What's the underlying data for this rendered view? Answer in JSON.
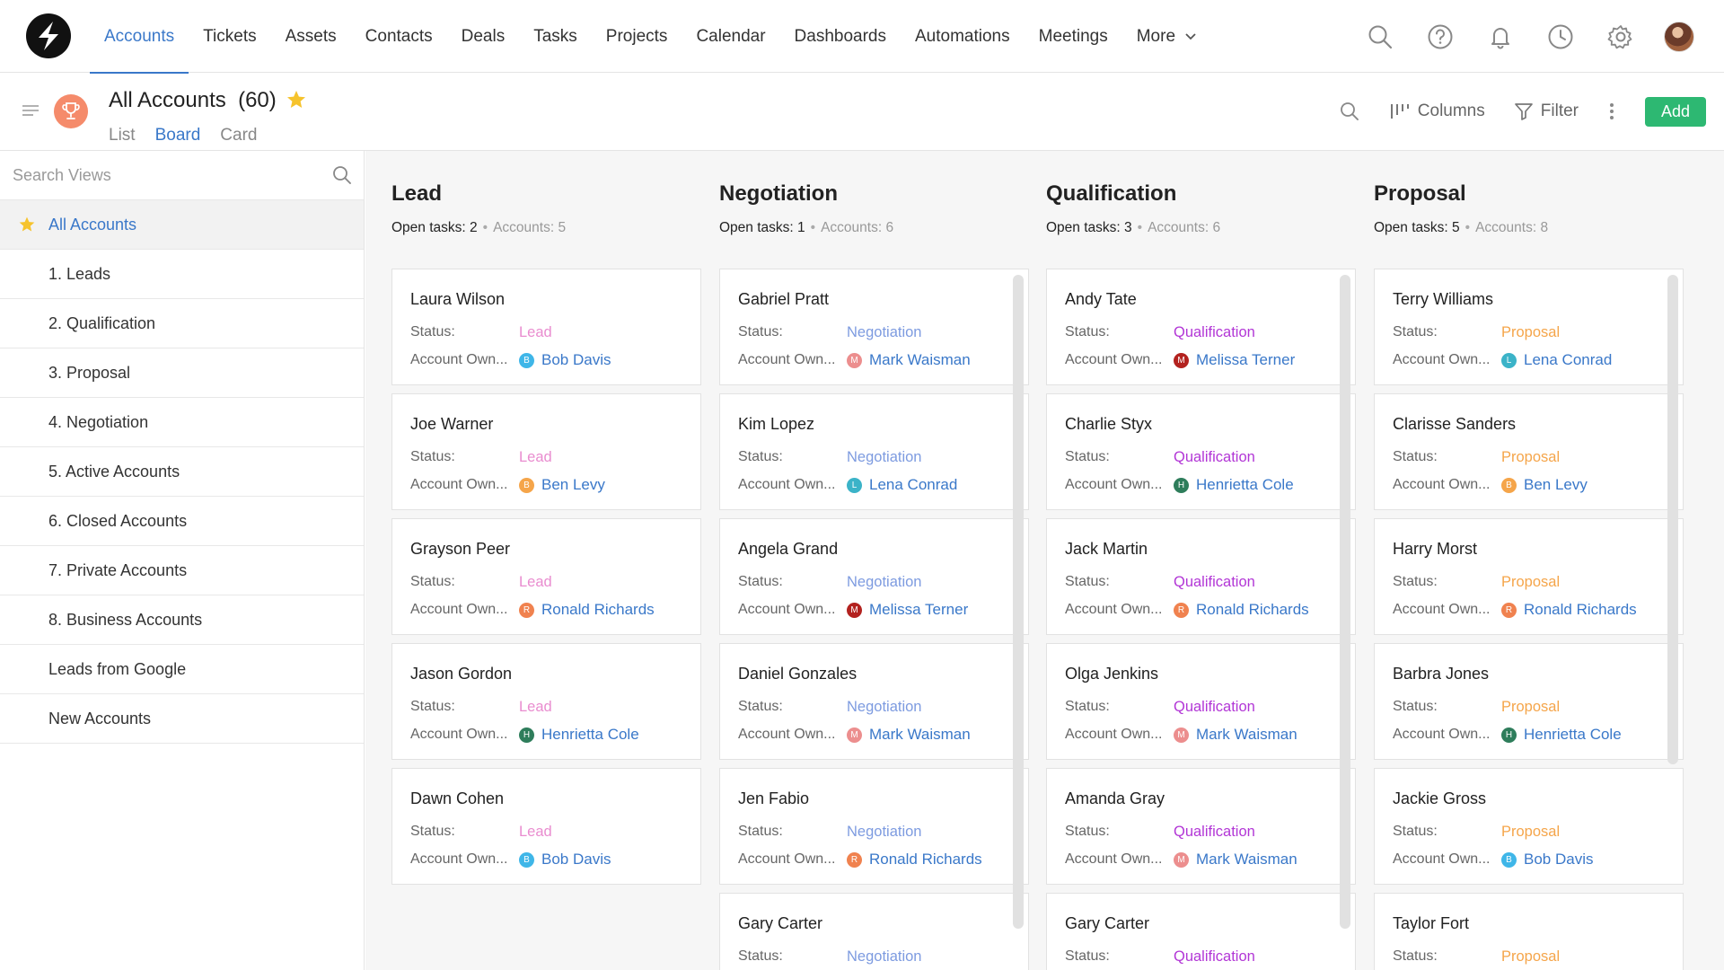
{
  "nav": {
    "links": [
      "Accounts",
      "Tickets",
      "Assets",
      "Contacts",
      "Deals",
      "Tasks",
      "Projects",
      "Calendar",
      "Dashboards",
      "Automations",
      "Meetings",
      "More"
    ],
    "active_index": 0
  },
  "header": {
    "title": "All Accounts",
    "count": "(60)",
    "view_tabs": [
      "List",
      "Board",
      "Card"
    ],
    "active_view": 1,
    "columns_label": "Columns",
    "filter_label": "Filter",
    "add_label": "Add"
  },
  "sidebar": {
    "search_placeholder": "Search Views",
    "items": [
      "All Accounts",
      "1. Leads",
      "2. Qualification",
      "3. Proposal",
      "4. Negotiation",
      "5. Active Accounts",
      "6. Closed Accounts",
      "7. Private Accounts",
      "8. Business Accounts",
      "Leads from Google",
      "New Accounts"
    ],
    "active_index": 0
  },
  "labels": {
    "status": "Status:",
    "owner": "Account Own..."
  },
  "owners": {
    "Bob Davis": {
      "initial": "B",
      "color": "#3fb6e8"
    },
    "Ben Levy": {
      "initial": "B",
      "color": "#f5a54a"
    },
    "Ronald Richards": {
      "initial": "R",
      "color": "#f0824f"
    },
    "Henrietta Cole": {
      "initial": "H",
      "color": "#2e7d5b"
    },
    "Mark Waisman": {
      "initial": "M",
      "color": "#ec8e8e"
    },
    "Lena Conrad": {
      "initial": "L",
      "color": "#3bb3c8"
    },
    "Melissa Terner": {
      "initial": "M",
      "color": "#b3221f"
    }
  },
  "columns": [
    {
      "title": "Lead",
      "open_tasks": "Open tasks: 2",
      "accounts": "Accounts: 5",
      "status": "Lead",
      "status_color": "#e98ccf",
      "cards": [
        {
          "name": "Laura Wilson",
          "owner": "Bob Davis"
        },
        {
          "name": "Joe Warner",
          "owner": "Ben Levy"
        },
        {
          "name": "Grayson Peer",
          "owner": "Ronald Richards"
        },
        {
          "name": "Jason Gordon",
          "owner": "Henrietta Cole"
        },
        {
          "name": "Dawn Cohen",
          "owner": "Bob Davis"
        }
      ]
    },
    {
      "title": "Negotiation",
      "open_tasks": "Open tasks: 1",
      "accounts": "Accounts: 6",
      "status": "Negotiation",
      "status_color": "#7d9be0",
      "cards": [
        {
          "name": "Gabriel Pratt",
          "owner": "Mark Waisman"
        },
        {
          "name": "Kim Lopez",
          "owner": "Lena Conrad"
        },
        {
          "name": "Angela Grand",
          "owner": "Melissa Terner"
        },
        {
          "name": "Daniel Gonzales",
          "owner": "Mark Waisman"
        },
        {
          "name": "Jen Fabio",
          "owner": "Ronald Richards"
        },
        {
          "name": "Gary Carter",
          "owner": ""
        }
      ]
    },
    {
      "title": "Qualification",
      "open_tasks": "Open tasks: 3",
      "accounts": "Accounts: 6",
      "status": "Qualification",
      "status_color": "#b236d6",
      "cards": [
        {
          "name": "Andy Tate",
          "owner": "Melissa Terner"
        },
        {
          "name": "Charlie Styx",
          "owner": "Henrietta Cole"
        },
        {
          "name": "Jack Martin",
          "owner": "Ronald Richards"
        },
        {
          "name": "Olga Jenkins",
          "owner": "Mark Waisman"
        },
        {
          "name": "Amanda Gray",
          "owner": "Mark Waisman"
        },
        {
          "name": "Gary Carter",
          "owner": ""
        }
      ]
    },
    {
      "title": "Proposal",
      "open_tasks": "Open tasks: 5",
      "accounts": "Accounts: 8",
      "status": "Proposal",
      "status_color": "#f5a54a",
      "cards": [
        {
          "name": "Terry Williams",
          "owner": "Lena Conrad"
        },
        {
          "name": "Clarisse Sanders",
          "owner": "Ben Levy"
        },
        {
          "name": "Harry Morst",
          "owner": "Ronald Richards"
        },
        {
          "name": "Barbra Jones",
          "owner": "Henrietta Cole"
        },
        {
          "name": "Jackie Gross",
          "owner": "Bob Davis"
        },
        {
          "name": "Taylor Fort",
          "owner": ""
        }
      ]
    }
  ]
}
